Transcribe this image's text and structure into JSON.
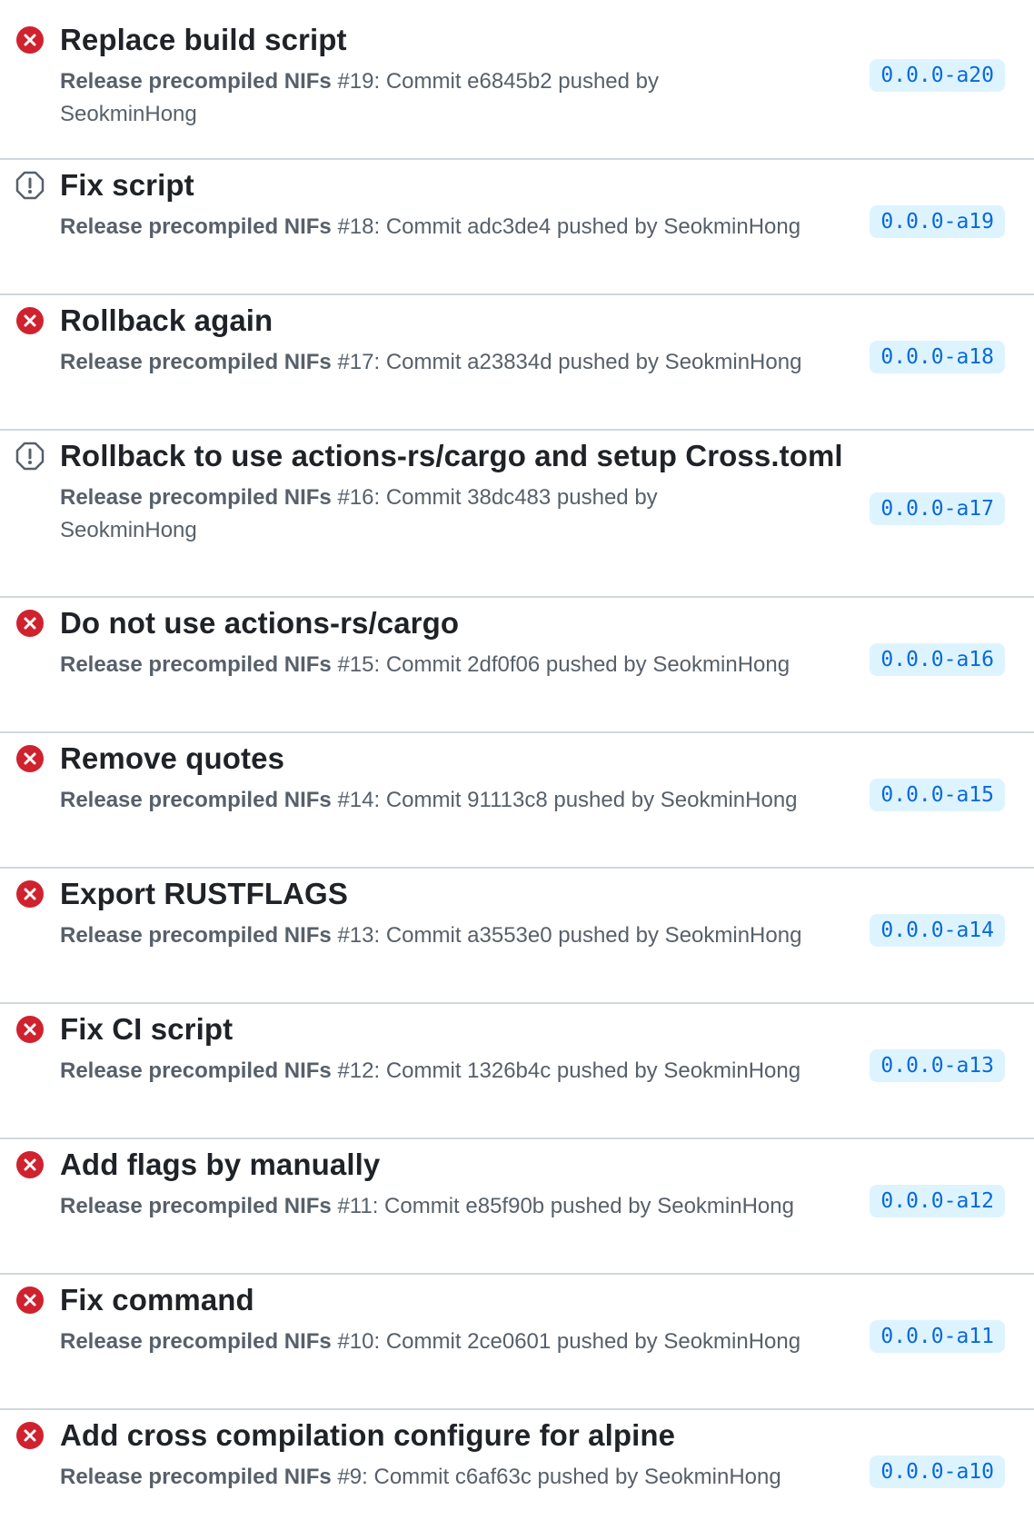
{
  "colors": {
    "failure": "#cf222e",
    "neutral": "#57606a",
    "badge_bg": "#ddf4ff",
    "badge_text": "#0969da",
    "divider": "#d0d7de"
  },
  "runs": [
    {
      "status": "failure",
      "status_icon": "x-circle-fill-icon",
      "title": "Replace build script",
      "workflow": "Release precompiled NIFs",
      "run_info": " #19: Commit e6845b2 pushed by SeokminHong",
      "branch": "0.0.0-a20"
    },
    {
      "status": "cancelled",
      "status_icon": "stop-circle-icon",
      "title": "Fix script",
      "workflow": "Release precompiled NIFs",
      "run_info": " #18: Commit adc3de4 pushed by SeokminHong",
      "branch": "0.0.0-a19"
    },
    {
      "status": "failure",
      "status_icon": "x-circle-fill-icon",
      "title": "Rollback again",
      "workflow": "Release precompiled NIFs",
      "run_info": " #17: Commit a23834d pushed by SeokminHong",
      "branch": "0.0.0-a18"
    },
    {
      "status": "cancelled",
      "status_icon": "stop-circle-icon",
      "title": "Rollback to use actions-rs/cargo and setup Cross.toml",
      "workflow": "Release precompiled NIFs",
      "run_info": " #16: Commit 38dc483 pushed by SeokminHong",
      "branch": "0.0.0-a17"
    },
    {
      "status": "failure",
      "status_icon": "x-circle-fill-icon",
      "title": "Do not use actions-rs/cargo",
      "workflow": "Release precompiled NIFs",
      "run_info": " #15: Commit 2df0f06 pushed by SeokminHong",
      "branch": "0.0.0-a16"
    },
    {
      "status": "failure",
      "status_icon": "x-circle-fill-icon",
      "title": "Remove quotes",
      "workflow": "Release precompiled NIFs",
      "run_info": " #14: Commit 91113c8 pushed by SeokminHong",
      "branch": "0.0.0-a15"
    },
    {
      "status": "failure",
      "status_icon": "x-circle-fill-icon",
      "title": "Export RUSTFLAGS",
      "workflow": "Release precompiled NIFs",
      "run_info": " #13: Commit a3553e0 pushed by SeokminHong",
      "branch": "0.0.0-a14"
    },
    {
      "status": "failure",
      "status_icon": "x-circle-fill-icon",
      "title": "Fix CI script",
      "workflow": "Release precompiled NIFs",
      "run_info": " #12: Commit 1326b4c pushed by SeokminHong",
      "branch": "0.0.0-a13"
    },
    {
      "status": "failure",
      "status_icon": "x-circle-fill-icon",
      "title": "Add flags by manually",
      "workflow": "Release precompiled NIFs",
      "run_info": " #11: Commit e85f90b pushed by SeokminHong",
      "branch": "0.0.0-a12"
    },
    {
      "status": "failure",
      "status_icon": "x-circle-fill-icon",
      "title": "Fix command",
      "workflow": "Release precompiled NIFs",
      "run_info": " #10: Commit 2ce0601 pushed by SeokminHong",
      "branch": "0.0.0-a11"
    },
    {
      "status": "failure",
      "status_icon": "x-circle-fill-icon",
      "title": "Add cross compilation configure for alpine",
      "workflow": "Release precompiled NIFs",
      "run_info": " #9: Commit c6af63c pushed by SeokminHong",
      "branch": "0.0.0-a10"
    }
  ]
}
